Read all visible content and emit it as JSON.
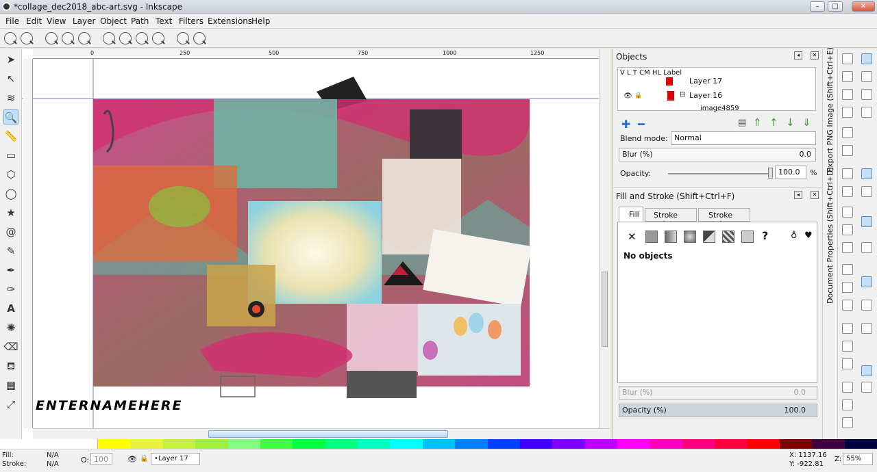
{
  "window": {
    "title": "*collage_dec2018_abc-art.svg - Inkscape",
    "min": "–",
    "max": "□",
    "close": "✕"
  },
  "menu": [
    "File",
    "Edit",
    "View",
    "Layer",
    "Object",
    "Path",
    "Text",
    "Filters",
    "Extensions",
    "Help"
  ],
  "ruler": {
    "labels": [
      "0",
      "250",
      "500",
      "750",
      "1000",
      "1250"
    ]
  },
  "canvas": {
    "text": "ENTERNAMEHERE"
  },
  "objects": {
    "title": "Objects",
    "columns": "V  L  T  CM HL Label",
    "rows": [
      "Layer 17",
      "Layer 16",
      "image4859"
    ],
    "blend_label": "Blend mode:",
    "blend_value": "Normal",
    "blur_label": "Blur (%)",
    "blur_value": "0.0",
    "opacity_label": "Opacity:",
    "opacity_value": "100.0",
    "opacity_unit": "%"
  },
  "fill_stroke": {
    "title": "Fill and Stroke (Shift+Ctrl+F)",
    "tabs": [
      "Fill",
      "Stroke paint",
      "Stroke style"
    ],
    "message": "No objects",
    "blur_label": "Blur (%)",
    "blur_value": "0.0",
    "opacity_label": "Opacity (%)",
    "opacity_value": "100.0"
  },
  "vertical_tabs": [
    "Export PNG Image (Shift+Ctrl+E)",
    "Document Properties (Shift+Ctrl+D)"
  ],
  "status": {
    "fill_label": "Fill:",
    "fill_value": "N/A",
    "stroke_label": "Stroke:",
    "stroke_value": "N/A",
    "o_label": "O:",
    "o_value": "100",
    "layer": "•Layer 17",
    "x": "X: 1137.16",
    "y": "Y: -922.81",
    "zoom_label": "Z:",
    "zoom": "55%"
  },
  "colors": {
    "accent": "#c5ddf5",
    "magenta": "#d0316f",
    "teal": "#57b7a5"
  }
}
